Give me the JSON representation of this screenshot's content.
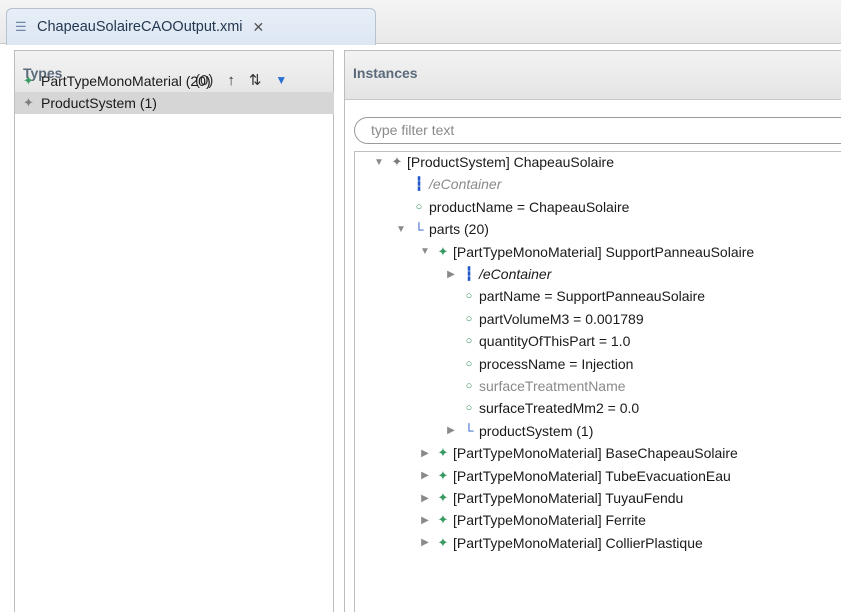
{
  "editor": {
    "tab_title": "ChapeauSolaireCAOOutput.xmi",
    "close_glyph": "✕"
  },
  "types_panel": {
    "title": "Types",
    "count": "(0)",
    "up_glyph": "↑",
    "sort_glyph": "⇅",
    "menu_glyph": "▼",
    "items": [
      {
        "label": "PartTypeMonoMaterial (20)",
        "icon": "green-diamond-icon",
        "selected": false
      },
      {
        "label": "ProductSystem (1)",
        "icon": "gray-diamond-icon",
        "selected": true
      }
    ]
  },
  "instances_panel": {
    "title": "Instances",
    "filter_placeholder": "type filter text",
    "tree": [
      {
        "indent": 0,
        "twisty": "expanded",
        "icon": "gray-diamond-icon",
        "label": "[ProductSystem] ChapeauSolaire",
        "style": ""
      },
      {
        "indent": 1,
        "twisty": "none",
        "icon": "container-ref-icon",
        "label": "/eContainer",
        "style": "ital muted"
      },
      {
        "indent": 1,
        "twisty": "none",
        "icon": "attribute-icon",
        "label": "productName = ChapeauSolaire",
        "style": ""
      },
      {
        "indent": 1,
        "twisty": "expanded",
        "icon": "containment-ref-icon",
        "label": "parts (20)",
        "style": ""
      },
      {
        "indent": 2,
        "twisty": "expanded",
        "icon": "green-diamond-icon",
        "label": "[PartTypeMonoMaterial] SupportPanneauSolaire",
        "style": ""
      },
      {
        "indent": 3,
        "twisty": "collapsed",
        "icon": "container-ref-icon",
        "label": "/eContainer",
        "style": "ital"
      },
      {
        "indent": 3,
        "twisty": "none",
        "icon": "attribute-icon",
        "label": "partName = SupportPanneauSolaire",
        "style": ""
      },
      {
        "indent": 3,
        "twisty": "none",
        "icon": "attribute-icon",
        "label": "partVolumeM3 = 0.001789",
        "style": ""
      },
      {
        "indent": 3,
        "twisty": "none",
        "icon": "attribute-icon",
        "label": "quantityOfThisPart = 1.0",
        "style": ""
      },
      {
        "indent": 3,
        "twisty": "none",
        "icon": "attribute-icon",
        "label": "processName = Injection",
        "style": ""
      },
      {
        "indent": 3,
        "twisty": "none",
        "icon": "attribute-icon",
        "label": "surfaceTreatmentName",
        "style": "muted"
      },
      {
        "indent": 3,
        "twisty": "none",
        "icon": "attribute-icon",
        "label": "surfaceTreatedMm2 = 0.0",
        "style": ""
      },
      {
        "indent": 3,
        "twisty": "collapsed",
        "icon": "reference-icon",
        "label": "productSystem (1)",
        "style": ""
      },
      {
        "indent": 2,
        "twisty": "collapsed",
        "icon": "green-diamond-icon",
        "label": "[PartTypeMonoMaterial] BaseChapeauSolaire",
        "style": ""
      },
      {
        "indent": 2,
        "twisty": "collapsed",
        "icon": "green-diamond-icon",
        "label": "[PartTypeMonoMaterial] TubeEvacuationEau",
        "style": ""
      },
      {
        "indent": 2,
        "twisty": "collapsed",
        "icon": "green-diamond-icon",
        "label": "[PartTypeMonoMaterial] TuyauFendu",
        "style": ""
      },
      {
        "indent": 2,
        "twisty": "collapsed",
        "icon": "green-diamond-icon",
        "label": "[PartTypeMonoMaterial] Ferrite",
        "style": ""
      },
      {
        "indent": 2,
        "twisty": "collapsed",
        "icon": "green-diamond-icon",
        "label": "[PartTypeMonoMaterial] CollierPlastique",
        "style": ""
      }
    ]
  },
  "colors": {
    "accent_blue": "#2a6fd1",
    "class_green": "#3a9a63",
    "selection_gray": "#d6d6d6"
  }
}
